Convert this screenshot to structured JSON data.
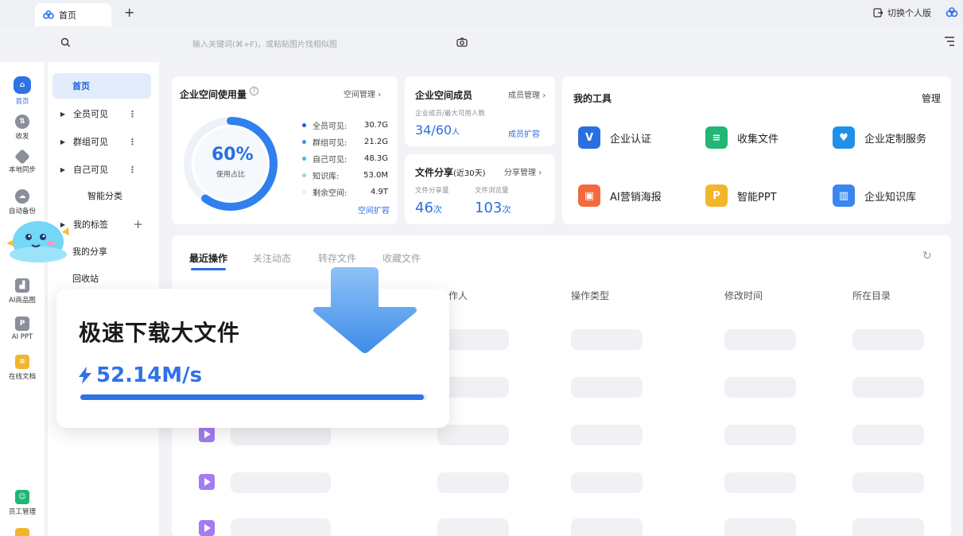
{
  "tabbar": {
    "home_tab": "首页",
    "switch_label": "切换个人版"
  },
  "search": {
    "placeholder": "输入关键词(⌘+F)，或粘贴图片找相似图"
  },
  "rail": {
    "home": "首页",
    "inbox": "收发",
    "sync": "本地同步",
    "backup": "自动备份",
    "ai_product": "AI商品图",
    "ai_ppt": "AI PPT",
    "online_docs": "在线文档",
    "staff": "员工管理"
  },
  "nav": {
    "home": "首页",
    "all_visible": "全员可见",
    "group_visible": "群组可见",
    "self_visible": "自己可见",
    "smart_category": "智能分类",
    "my_tags": "我的标签",
    "my_share": "我的分享",
    "recycle": "回收站"
  },
  "usage": {
    "title": "企业空间使用量",
    "manage": "空间管理",
    "percent_text": "60%",
    "percent_label": "使用占比",
    "percent": 0.6,
    "expand": "空间扩容",
    "items": [
      {
        "label": "全员可见:",
        "value": "30.7G",
        "color": "#2a5bd7"
      },
      {
        "label": "群组可见:",
        "value": "21.2G",
        "color": "#3f8bf0"
      },
      {
        "label": "自己可见:",
        "value": "48.3G",
        "color": "#48b6e8"
      },
      {
        "label": "知识库:",
        "value": "53.0M",
        "color": "#8fd9e8"
      },
      {
        "label": "剩余空间:",
        "value": "4.9T",
        "color": "#e8eef8"
      }
    ]
  },
  "members": {
    "title": "企业空间成员",
    "manage": "成员管理",
    "subtitle": "企业成员/最大可用人数",
    "count": "34/60",
    "unit": "人",
    "expand": "成员扩容"
  },
  "share": {
    "title": "文件分享",
    "period": "(近30天)",
    "manage": "分享管理",
    "share_label": "文件分享量",
    "share_value": "46",
    "share_unit": "次",
    "view_label": "文件浏览量",
    "view_value": "103",
    "view_unit": "次"
  },
  "tools": {
    "title": "我的工具",
    "manage": "管理",
    "items": [
      {
        "label": "企业认证",
        "icon": "V",
        "color": "#2a6fe0"
      },
      {
        "label": "收集文件",
        "icon": "≡",
        "color": "#22b573"
      },
      {
        "label": "企业定制服务",
        "icon": "♥",
        "color": "#1e90e8"
      },
      {
        "label": "AI营销海报",
        "icon": "▣",
        "color": "#f26a3d"
      },
      {
        "label": "智能PPT",
        "icon": "P",
        "color": "#f3b52b"
      },
      {
        "label": "企业知识库",
        "icon": "▥",
        "color": "#3a86f0"
      }
    ]
  },
  "recent": {
    "tabs": [
      "最近操作",
      "关注动态",
      "转存文件",
      "收藏文件"
    ],
    "columns": [
      "作人",
      "操作类型",
      "修改时间",
      "所在目录"
    ]
  },
  "download": {
    "title": "极速下载大文件",
    "speed": "52.14M/s",
    "progress": 0.99
  }
}
